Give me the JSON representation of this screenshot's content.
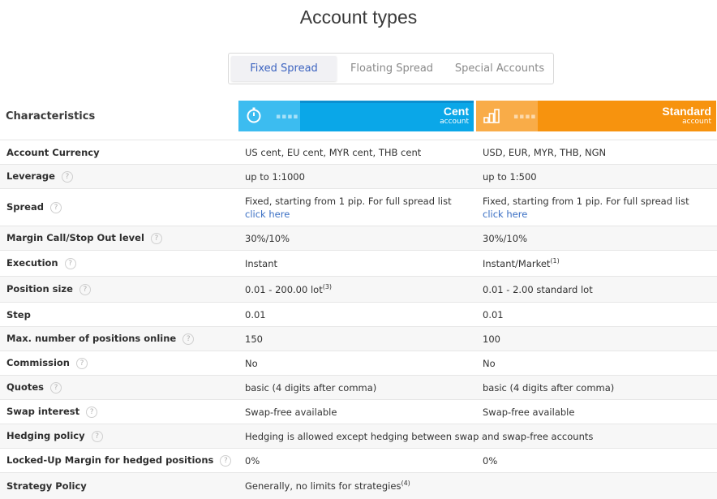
{
  "page_title": "Account types",
  "tabs": [
    {
      "label": "Fixed Spread",
      "active": true
    },
    {
      "label": "Floating Spread",
      "active": false
    },
    {
      "label": "Special Accounts",
      "active": false
    }
  ],
  "characteristics_label": "Characteristics",
  "accounts": [
    {
      "name": "Cent",
      "sub": "account",
      "color": "#0aa7e8",
      "icon": "stopwatch-icon"
    },
    {
      "name": "Standard",
      "sub": "account",
      "color": "#f7930e",
      "icon": "chart-icon"
    }
  ],
  "rows": [
    {
      "label": "Account Currency",
      "help": false,
      "v1": "US cent, EU cent, MYR cent, THB cent",
      "v2": "USD, EUR, MYR, THB, NGN"
    },
    {
      "label": "Leverage",
      "help": true,
      "v1": "up to 1:1000",
      "v2": "up to 1:500"
    },
    {
      "label": "Spread",
      "help": true,
      "v1": "Fixed, starting from 1 pip. For full spread list",
      "v1_link": "click here",
      "v2": "Fixed, starting from 1 pip. For full spread list",
      "v2_link": "click here"
    },
    {
      "label": "Margin Call/Stop Out level",
      "help": true,
      "v1": "30%/10%",
      "v2": "30%/10%"
    },
    {
      "label": "Execution",
      "help": true,
      "v1": "Instant",
      "v2": "Instant/Market",
      "v2_sup": "(1)"
    },
    {
      "label": "Position size",
      "help": true,
      "v1": "0.01 - 200.00 lot",
      "v1_sup": "(3)",
      "v2": "0.01 - 2.00 standard lot"
    },
    {
      "label": "Step",
      "help": false,
      "v1": "0.01",
      "v2": "0.01"
    },
    {
      "label": "Max. number of positions online",
      "help": true,
      "v1": "150",
      "v2": "100"
    },
    {
      "label": "Commission",
      "help": true,
      "v1": "No",
      "v2": "No"
    },
    {
      "label": "Quotes",
      "help": true,
      "v1": "basic (4 digits after comma)",
      "v2": "basic (4 digits after comma)"
    },
    {
      "label": "Swap interest",
      "help": true,
      "v1": "Swap-free available",
      "v2": "Swap-free available"
    },
    {
      "label": "Hedging policy",
      "help": true,
      "span": "Hedging is allowed except hedging between swap and swap-free accounts"
    },
    {
      "label": "Locked-Up Margin for hedged positions",
      "help": true,
      "v1": "0%",
      "v2": "0%"
    },
    {
      "label": "Strategy Policy",
      "help": false,
      "span": "Generally, no limits for strategies",
      "span_sup": "(4)"
    }
  ],
  "help_glyph": "?"
}
